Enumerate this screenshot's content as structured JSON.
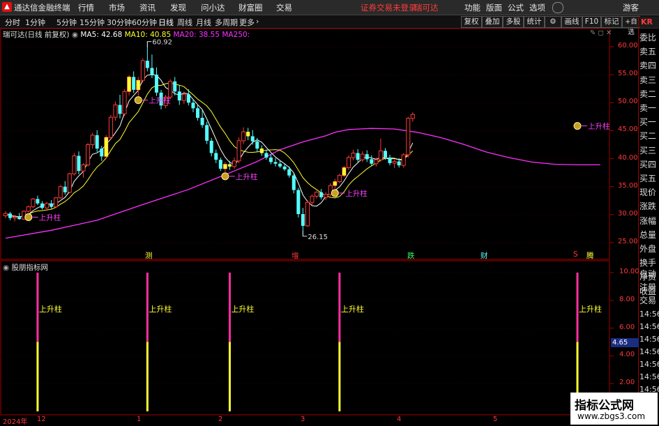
{
  "titlebar": {
    "app_name": "通达信金融终端",
    "menu": [
      "行情",
      "市场",
      "资讯",
      "发现",
      "问小达",
      "财富圈",
      "交易"
    ],
    "warning": "证券交易未登录",
    "stock": "瑞可达",
    "right_menu": [
      "功能",
      "版面",
      "公式",
      "选项",
      "游客"
    ]
  },
  "toolbar": {
    "periods": [
      "分时",
      "1分钟",
      "5分钟",
      "15分钟",
      "30分钟",
      "60分钟",
      "日线",
      "周线",
      "月线",
      "多周期",
      "更多"
    ],
    "active_period": "日线",
    "buttons": [
      "复权",
      "叠加",
      "多股",
      "统计",
      "画线",
      "F10",
      "标记",
      "+自选"
    ]
  },
  "chart_header": {
    "stock_label": "瑞可达(日线 前复权)",
    "ma5": "MA5: 42.68",
    "ma10": "MA10: 40.85",
    "ma20": "MA20: 38.55",
    "ma250": "MA250:"
  },
  "right_panel": {
    "kr": "KR",
    "top_labels": [
      "委比",
      "卖五",
      "卖四",
      "卖三",
      "卖二",
      "卖一",
      "买一",
      "买二",
      "买三",
      "买四",
      "买五",
      "现价",
      "涨跌",
      "涨幅",
      "总量",
      "外盘",
      "换手",
      "净资",
      "收益"
    ],
    "bottom_labels": [
      "自动",
      "注册",
      "交易"
    ],
    "times": [
      "14:56",
      "14:56",
      "14:56",
      "14:56",
      "14:56",
      "14:56",
      "14:56"
    ]
  },
  "indicator": {
    "name": "股朋指标网",
    "current_value": "4.65",
    "bar_label": "上升柱",
    "ticks": [
      "10.00",
      "8.00",
      "6.00",
      "4.00",
      "2.00"
    ]
  },
  "colors": {
    "up": "#ff3a3a",
    "down": "#54ffff",
    "yellow": "#ffff30",
    "ma5": "#ffffff",
    "ma10": "#ffff30",
    "ma250": "#ff30ff",
    "magenta_bar": "#ff30a0"
  },
  "chart_data": {
    "type": "candlestick",
    "price_ticks": [
      "60.00",
      "55.00",
      "50.00",
      "45.00",
      "40.00",
      "35.00",
      "30.00",
      "25.00"
    ],
    "ylim": [
      23.5,
      62.5
    ],
    "high_annotation": "60.92",
    "low_annotation": "26.15",
    "annotation_label": "上升柱",
    "event_labels": [
      "测",
      "增",
      "跌",
      "财",
      "S",
      "腾"
    ],
    "x_labels": [
      "2024年",
      "12",
      "1",
      "2",
      "3",
      "4",
      "5"
    ],
    "candles": [
      [
        29.8,
        30.6,
        29.4,
        30.2
      ],
      [
        30.2,
        30.5,
        29.0,
        29.4
      ],
      [
        29.4,
        29.9,
        28.8,
        29.6
      ],
      [
        29.6,
        30.3,
        29.1,
        29.2
      ],
      [
        29.2,
        30.8,
        29.0,
        30.6
      ],
      [
        30.6,
        31.6,
        30.3,
        31.4
      ],
      [
        31.4,
        33.0,
        31.2,
        32.8
      ],
      [
        32.8,
        33.4,
        31.7,
        32.0
      ],
      [
        32.0,
        32.4,
        30.9,
        31.2
      ],
      [
        31.2,
        32.3,
        30.7,
        32.0
      ],
      [
        32.0,
        32.6,
        31.1,
        31.4
      ],
      [
        31.4,
        33.2,
        31.2,
        33.0
      ],
      [
        33.0,
        35.3,
        32.8,
        35.0
      ],
      [
        35.0,
        36.0,
        33.6,
        34.0
      ],
      [
        34.0,
        37.5,
        33.8,
        37.3
      ],
      [
        37.3,
        41.0,
        37.0,
        40.5
      ],
      [
        40.5,
        41.3,
        37.2,
        37.8
      ],
      [
        37.8,
        39.2,
        36.6,
        38.9
      ],
      [
        38.9,
        42.8,
        38.6,
        42.5
      ],
      [
        42.5,
        44.6,
        41.8,
        44.2
      ],
      [
        44.2,
        45.1,
        41.2,
        41.8
      ],
      [
        41.8,
        42.3,
        39.6,
        40.4
      ],
      [
        40.4,
        44.2,
        40.0,
        43.8
      ],
      [
        43.8,
        47.8,
        43.4,
        47.4
      ],
      [
        47.4,
        50.2,
        46.8,
        49.6
      ],
      [
        49.6,
        51.4,
        47.2,
        48.0
      ],
      [
        48.0,
        52.4,
        47.6,
        52.0
      ],
      [
        52.0,
        54.9,
        51.3,
        54.6
      ],
      [
        54.6,
        55.6,
        51.7,
        52.3
      ],
      [
        52.3,
        54.6,
        51.2,
        54.0
      ],
      [
        54.0,
        57.9,
        53.6,
        57.5
      ],
      [
        57.5,
        60.9,
        55.6,
        56.2
      ],
      [
        56.2,
        58.6,
        54.4,
        55.0
      ],
      [
        55.0,
        56.3,
        51.2,
        51.8
      ],
      [
        51.8,
        52.3,
        48.8,
        49.5
      ],
      [
        49.5,
        51.4,
        49.0,
        51.0
      ],
      [
        51.0,
        54.2,
        50.6,
        53.8
      ],
      [
        53.8,
        54.6,
        51.3,
        52.0
      ],
      [
        52.0,
        53.1,
        49.6,
        50.4
      ],
      [
        50.4,
        52.0,
        49.8,
        51.5
      ],
      [
        51.5,
        52.4,
        49.5,
        50.0
      ],
      [
        50.0,
        50.6,
        48.3,
        49.0
      ],
      [
        49.0,
        49.6,
        46.8,
        47.3
      ],
      [
        47.3,
        48.7,
        45.5,
        46.0
      ],
      [
        46.0,
        46.6,
        42.6,
        43.2
      ],
      [
        43.2,
        43.7,
        40.4,
        41.0
      ],
      [
        41.0,
        41.6,
        39.2,
        39.8
      ],
      [
        39.8,
        40.2,
        37.8,
        38.2
      ],
      [
        38.2,
        39.4,
        37.6,
        39.0
      ],
      [
        39.0,
        39.6,
        38.0,
        38.6
      ],
      [
        38.6,
        40.2,
        38.2,
        39.6
      ],
      [
        39.6,
        43.8,
        39.2,
        43.2
      ],
      [
        43.2,
        45.6,
        42.6,
        44.8
      ],
      [
        44.8,
        45.5,
        43.3,
        44.0
      ],
      [
        44.0,
        45.1,
        42.5,
        43.1
      ],
      [
        43.1,
        43.7,
        41.2,
        41.8
      ],
      [
        41.8,
        42.4,
        40.5,
        41.0
      ],
      [
        41.0,
        41.6,
        39.8,
        40.2
      ],
      [
        40.2,
        40.8,
        39.0,
        39.4
      ],
      [
        39.4,
        40.1,
        38.6,
        39.1
      ],
      [
        39.1,
        39.7,
        38.3,
        38.6
      ],
      [
        38.6,
        39.2,
        37.8,
        38.1
      ],
      [
        38.1,
        38.6,
        36.6,
        37.0
      ],
      [
        37.0,
        37.5,
        33.8,
        34.4
      ],
      [
        34.4,
        34.8,
        29.5,
        30.1
      ],
      [
        30.1,
        31.2,
        26.2,
        28.0
      ],
      [
        28.0,
        32.6,
        27.8,
        32.2
      ],
      [
        32.2,
        33.6,
        31.7,
        33.3
      ],
      [
        33.3,
        34.3,
        32.9,
        34.0
      ],
      [
        34.0,
        34.6,
        32.7,
        33.1
      ],
      [
        33.1,
        34.0,
        32.6,
        33.6
      ],
      [
        33.6,
        35.6,
        33.3,
        35.2
      ],
      [
        35.2,
        36.4,
        34.6,
        35.9
      ],
      [
        35.9,
        37.3,
        35.6,
        37.0
      ],
      [
        37.0,
        38.7,
        36.7,
        38.4
      ],
      [
        38.4,
        40.6,
        38.0,
        40.2
      ],
      [
        40.2,
        41.6,
        39.7,
        41.0
      ],
      [
        41.0,
        41.7,
        39.4,
        39.8
      ],
      [
        39.8,
        41.3,
        39.4,
        40.8
      ],
      [
        40.8,
        41.5,
        39.4,
        39.9
      ],
      [
        39.9,
        40.6,
        38.7,
        39.1
      ],
      [
        39.1,
        40.2,
        38.6,
        39.8
      ],
      [
        39.8,
        43.6,
        39.5,
        41.4
      ],
      [
        41.4,
        41.9,
        39.8,
        40.2
      ],
      [
        40.2,
        40.7,
        38.8,
        39.2
      ],
      [
        39.2,
        39.9,
        38.3,
        39.5
      ],
      [
        39.5,
        40.1,
        38.4,
        38.8
      ],
      [
        38.8,
        41.0,
        38.4,
        40.7
      ],
      [
        40.7,
        47.5,
        40.2,
        47.2
      ],
      [
        47.2,
        48.3,
        46.6,
        47.9
      ]
    ],
    "ma250": [
      [
        0,
        25.8
      ],
      [
        10,
        27.2
      ],
      [
        20,
        29.0
      ],
      [
        30,
        31.8
      ],
      [
        40,
        34.5
      ],
      [
        50,
        37.8
      ],
      [
        55,
        39.5
      ],
      [
        60,
        41.6
      ],
      [
        65,
        43.0
      ],
      [
        70,
        44.1
      ],
      [
        72,
        44.7
      ],
      [
        75,
        45.2
      ],
      [
        80,
        45.4
      ],
      [
        85,
        45.3
      ],
      [
        90,
        44.7
      ],
      [
        95,
        43.8
      ],
      [
        100,
        42.6
      ],
      [
        105,
        41.2
      ],
      [
        110,
        40.2
      ],
      [
        115,
        39.4
      ],
      [
        120,
        39.0
      ],
      [
        125,
        38.9
      ],
      [
        130,
        38.9
      ]
    ],
    "signal_candles": [
      5,
      29,
      48,
      72,
      125
    ],
    "indicator_ylim": [
      0,
      11
    ],
    "indicator_bars": [
      {
        "x": 7,
        "total": 10.0,
        "yellow": 5.0
      },
      {
        "x": 31,
        "total": 10.0,
        "yellow": 5.0
      },
      {
        "x": 49,
        "total": 10.0,
        "yellow": 5.0
      },
      {
        "x": 73,
        "total": 10.0,
        "yellow": 5.0
      },
      {
        "x": 125,
        "total": 10.0,
        "yellow": 5.0
      }
    ]
  }
}
